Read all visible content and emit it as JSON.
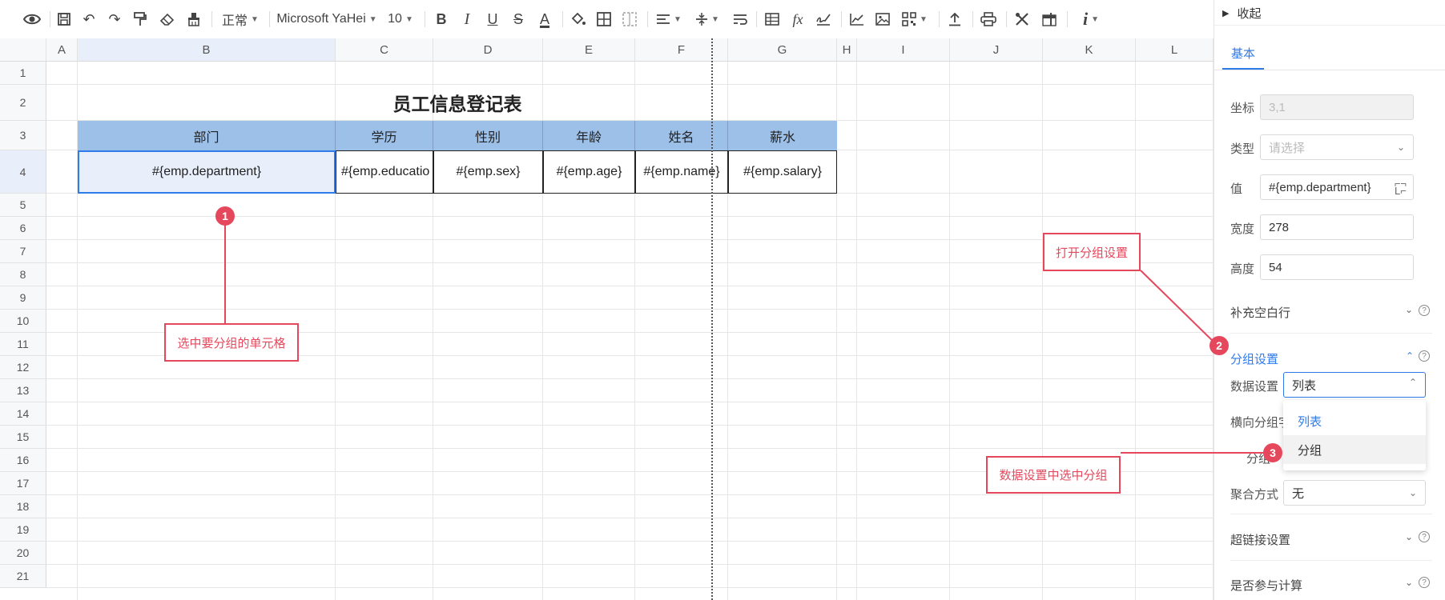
{
  "toolbar": {
    "style_label": "正常",
    "font_family": "Microsoft YaHei",
    "font_size": "10"
  },
  "sheet": {
    "columns": [
      "A",
      "B",
      "C",
      "D",
      "E",
      "F",
      "G",
      "H",
      "I",
      "J",
      "K",
      "L"
    ],
    "rows": [
      "1",
      "2",
      "3",
      "4",
      "5",
      "6",
      "7",
      "8",
      "9",
      "10",
      "11",
      "12",
      "13",
      "14",
      "15",
      "16",
      "17",
      "18",
      "19",
      "20",
      "21"
    ],
    "title": "员工信息登记表",
    "headers": [
      "部门",
      "学历",
      "性别",
      "年龄",
      "姓名",
      "薪水"
    ],
    "values": [
      "#{emp.department}",
      "#{emp.educatio",
      "#{emp.sex}",
      "#{emp.age}",
      "#{emp.name}",
      "#{emp.salary}"
    ]
  },
  "annotations": {
    "step1_num": "1",
    "step1_text": "选中要分组的单元格",
    "step2_num": "2",
    "step2_text": "打开分组设置",
    "step3_num": "3",
    "step3_text": "数据设置中选中分组",
    "color": "#e5485c"
  },
  "panel": {
    "collapse_label": "收起",
    "tab_basic": "基本",
    "coord_label": "坐标",
    "coord_value": "3,1",
    "type_label": "类型",
    "type_placeholder": "请选择",
    "value_label": "值",
    "value_value": "#{emp.department}",
    "width_label": "宽度",
    "width_value": "278",
    "height_label": "高度",
    "height_value": "54",
    "fill_blank_label": "补充空白行",
    "group_settings_label": "分组设置",
    "data_settings_label": "数据设置",
    "data_settings_value": "列表",
    "horizontal_group_label": "横向分组字",
    "group_partial_label": "分组",
    "aggregate_label": "聚合方式",
    "aggregate_value": "无",
    "hyperlink_label": "超链接设置",
    "calc_label": "是否参与计算",
    "accent": "#2f7bea"
  },
  "dropdown": {
    "options": [
      "列表",
      "分组"
    ]
  }
}
